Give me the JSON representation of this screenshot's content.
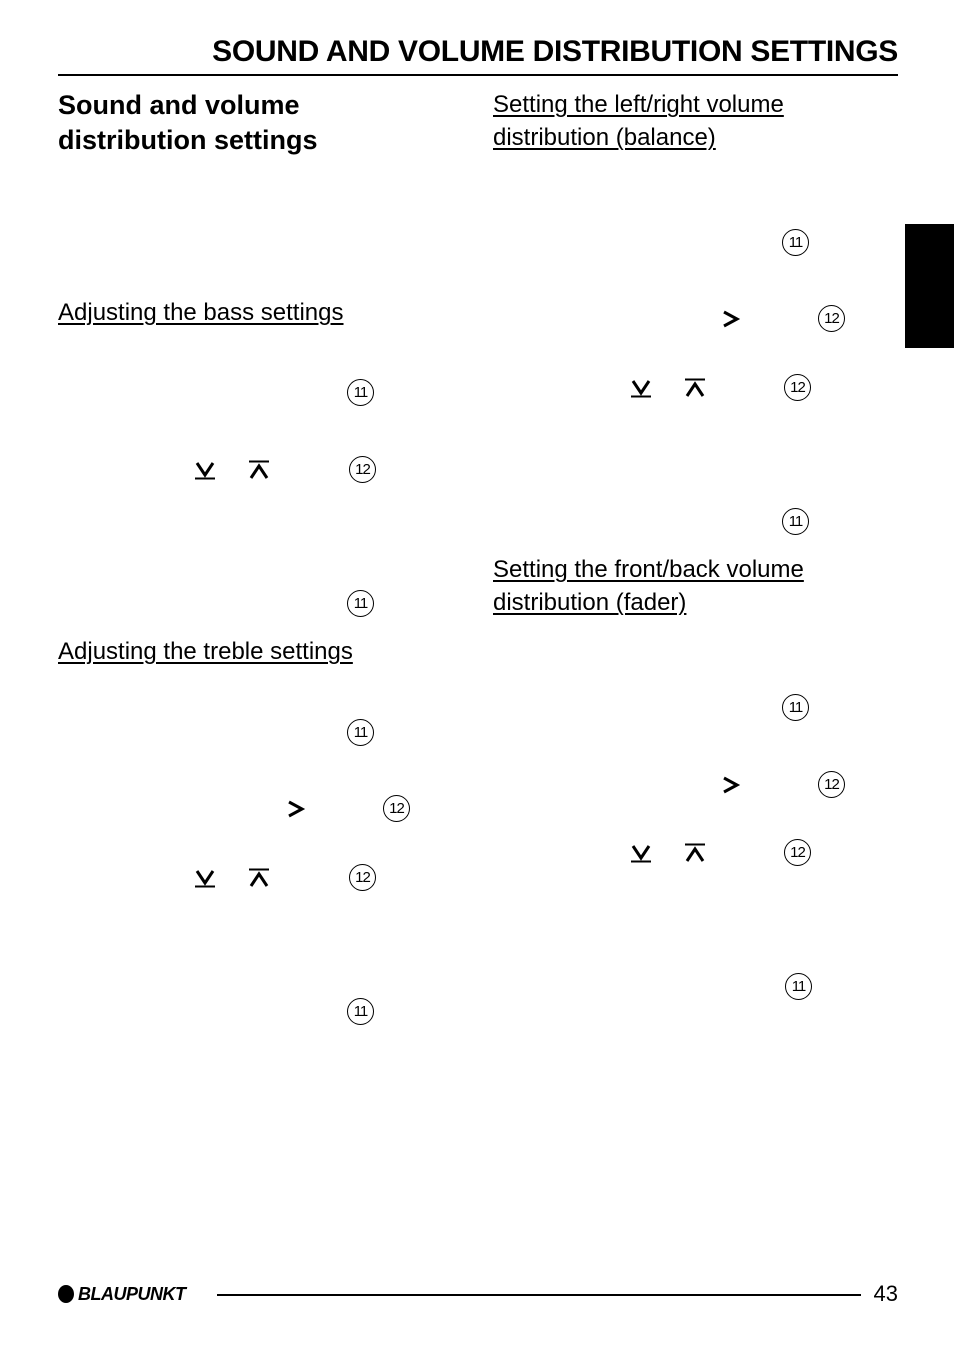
{
  "header": {
    "title": "SOUND AND VOLUME DISTRIBUTION SETTINGS"
  },
  "left_column": {
    "intro_heading": "Sound and volume distribution settings",
    "bass": {
      "heading": "Adjusting the bass settings",
      "refs": [
        "11",
        "12",
        "11"
      ]
    },
    "treble": {
      "heading": "Adjusting the treble settings",
      "refs": [
        "11",
        "12",
        "12",
        "11"
      ]
    }
  },
  "right_column": {
    "balance": {
      "heading_line1": "Setting the left/right volume",
      "heading_line2": "distribution (balance)",
      "refs": [
        "11",
        "12",
        "12",
        "11"
      ]
    },
    "fader": {
      "heading_line1": "Setting the front/back volume",
      "heading_line2": "distribution (fader)",
      "refs": [
        "11",
        "12",
        "12",
        "11"
      ]
    }
  },
  "icons": {
    "down": "down-key-icon",
    "up": "up-key-icon",
    "right": "right-key-icon"
  },
  "footer": {
    "brand": "BLAUPUNKT",
    "page_number": "43"
  },
  "colors": {
    "text": "#000000",
    "background": "#ffffff",
    "tab": "#000000"
  }
}
